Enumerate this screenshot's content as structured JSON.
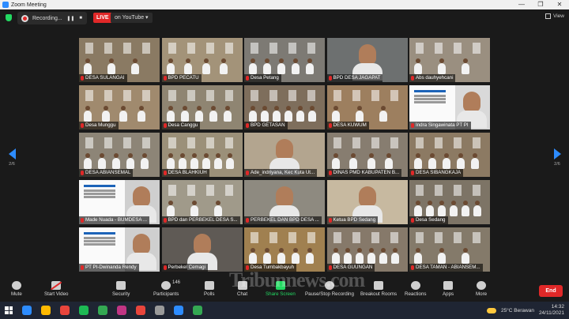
{
  "window": {
    "title": "Zoom Meeting",
    "controls": [
      "—",
      "❐",
      "✕"
    ]
  },
  "topbar": {
    "recording_label": "Recording...",
    "pause_glyph": "❚❚",
    "stop_glyph": "■",
    "live_label": "LIVE",
    "stream_label": "on YouTube ▾",
    "view_label": "View"
  },
  "pager": {
    "left": "2/6",
    "right": "2/6"
  },
  "tiles": [
    {
      "label": "DESA SULANGAI",
      "muted": true,
      "kind": "room",
      "bg": "#8a7a63"
    },
    {
      "label": "BPD PECATU",
      "muted": true,
      "kind": "room",
      "bg": "#a39379"
    },
    {
      "label": "Desa Petang",
      "muted": true,
      "kind": "room",
      "bg": "#7d7a74"
    },
    {
      "label": "BPD DESA JAGAPAT",
      "muted": true,
      "kind": "face",
      "bg": "#6d7070"
    },
    {
      "label": "Abs dauhyehcani",
      "muted": true,
      "kind": "room",
      "bg": "#9a8f80"
    },
    {
      "label": "Desa Munggu",
      "muted": true,
      "kind": "room",
      "bg": "#a08a6e"
    },
    {
      "label": "Desa Canggu",
      "muted": true,
      "kind": "room",
      "bg": "#8f8572"
    },
    {
      "label": "BPD GETASAN",
      "muted": true,
      "kind": "room",
      "bg": "#7e6e5c"
    },
    {
      "label": "DESA KUWUM",
      "muted": true,
      "kind": "room",
      "bg": "#9d7f5f"
    },
    {
      "label": "Indra Singawinata PT PI",
      "muted": true,
      "kind": "slide",
      "bg": "#d9d9d9"
    },
    {
      "label": "DESA ABIANSEMAL",
      "muted": true,
      "kind": "room",
      "bg": "#8d8577"
    },
    {
      "label": "DESA BLAHKIUH",
      "muted": true,
      "kind": "room",
      "bg": "#9b9079"
    },
    {
      "label": "Ade_indriyana, Kec Kuta Ut...",
      "muted": true,
      "kind": "face",
      "bg": "#b3a58f"
    },
    {
      "label": "DINAS PMD KABUPATEN B...",
      "muted": true,
      "kind": "room",
      "bg": "#877d70"
    },
    {
      "label": "DESA SIBANGKAJA",
      "muted": true,
      "kind": "room",
      "bg": "#8c7a63"
    },
    {
      "label": "Made Nuada - BUMDESA ...",
      "muted": true,
      "kind": "slide",
      "bg": "#cfcfcf"
    },
    {
      "label": "BPD dan PERBEKEL DESA S...",
      "muted": true,
      "kind": "room",
      "bg": "#a09a8a"
    },
    {
      "label": "PERBEKEL DAN BPD DESA ...",
      "muted": true,
      "kind": "face",
      "bg": "#8e8a80"
    },
    {
      "label": "Ketua BPD Sedang",
      "muted": true,
      "kind": "face",
      "bg": "#c7b9a0"
    },
    {
      "label": "Desa Sedang",
      "muted": true,
      "kind": "room",
      "bg": "#7d7466"
    },
    {
      "label": "PT PI-Dwinanda Rendy",
      "muted": true,
      "kind": "slide",
      "bg": "#cfcfcf"
    },
    {
      "label": "Perbekel Cemagi",
      "muted": true,
      "kind": "face",
      "bg": "#5f5a55"
    },
    {
      "label": "Desa Tumbakbayuh",
      "muted": true,
      "kind": "room",
      "bg": "#a08050"
    },
    {
      "label": "DESA GUUNGAN",
      "muted": true,
      "kind": "room",
      "bg": "#86796a"
    },
    {
      "label": "DESA TAMAN - ABIANSEM...",
      "muted": true,
      "kind": "room",
      "bg": "#847a6a"
    }
  ],
  "toolbar": {
    "mute": "Mute",
    "start_video": "Start Video",
    "security": "Security",
    "participants": "Participants",
    "participants_count": "146",
    "polls": "Polls",
    "chat": "Chat",
    "share_screen": "Share Screen",
    "pause_recording": "Pause/Stop Recording",
    "breakout": "Breakout Rooms",
    "reactions": "Reactions",
    "apps": "Apps",
    "more": "More",
    "end": "End"
  },
  "watermark": "Tribunnews.com",
  "taskbar": {
    "weather": "25°C  Berawan",
    "time": "14:32",
    "date": "24/11/2021",
    "app_colors": [
      "#2d8cff",
      "#ffb900",
      "#e8453c",
      "#1db954",
      "#34a853",
      "#c13584",
      "#e8453c",
      "#9a9a9a",
      "#2d8cff",
      "#34a853"
    ]
  }
}
